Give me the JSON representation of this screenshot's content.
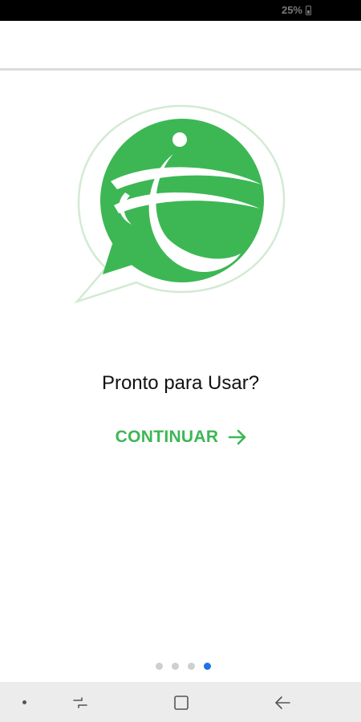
{
  "status_bar": {
    "battery_text": "25%",
    "battery_icon": "battery-icon"
  },
  "logo": {
    "icon": "app-logo-speech-bubble-globe",
    "bubble_border_color": "#cfe9cf",
    "circle_color": "#3cb754"
  },
  "onboarding": {
    "headline": "Pronto para Usar?",
    "continue_label": "CONTINUAR",
    "continue_icon": "arrow-right-icon",
    "accent_color": "#3cb754"
  },
  "page_indicator": {
    "total_pages": 4,
    "current_page": 4,
    "active_color": "#1e73e8",
    "inactive_color": "#cfcfcf"
  },
  "nav_bar": {
    "items": [
      "dot-indicator",
      "recent-apps-icon",
      "home-icon",
      "back-icon"
    ]
  }
}
